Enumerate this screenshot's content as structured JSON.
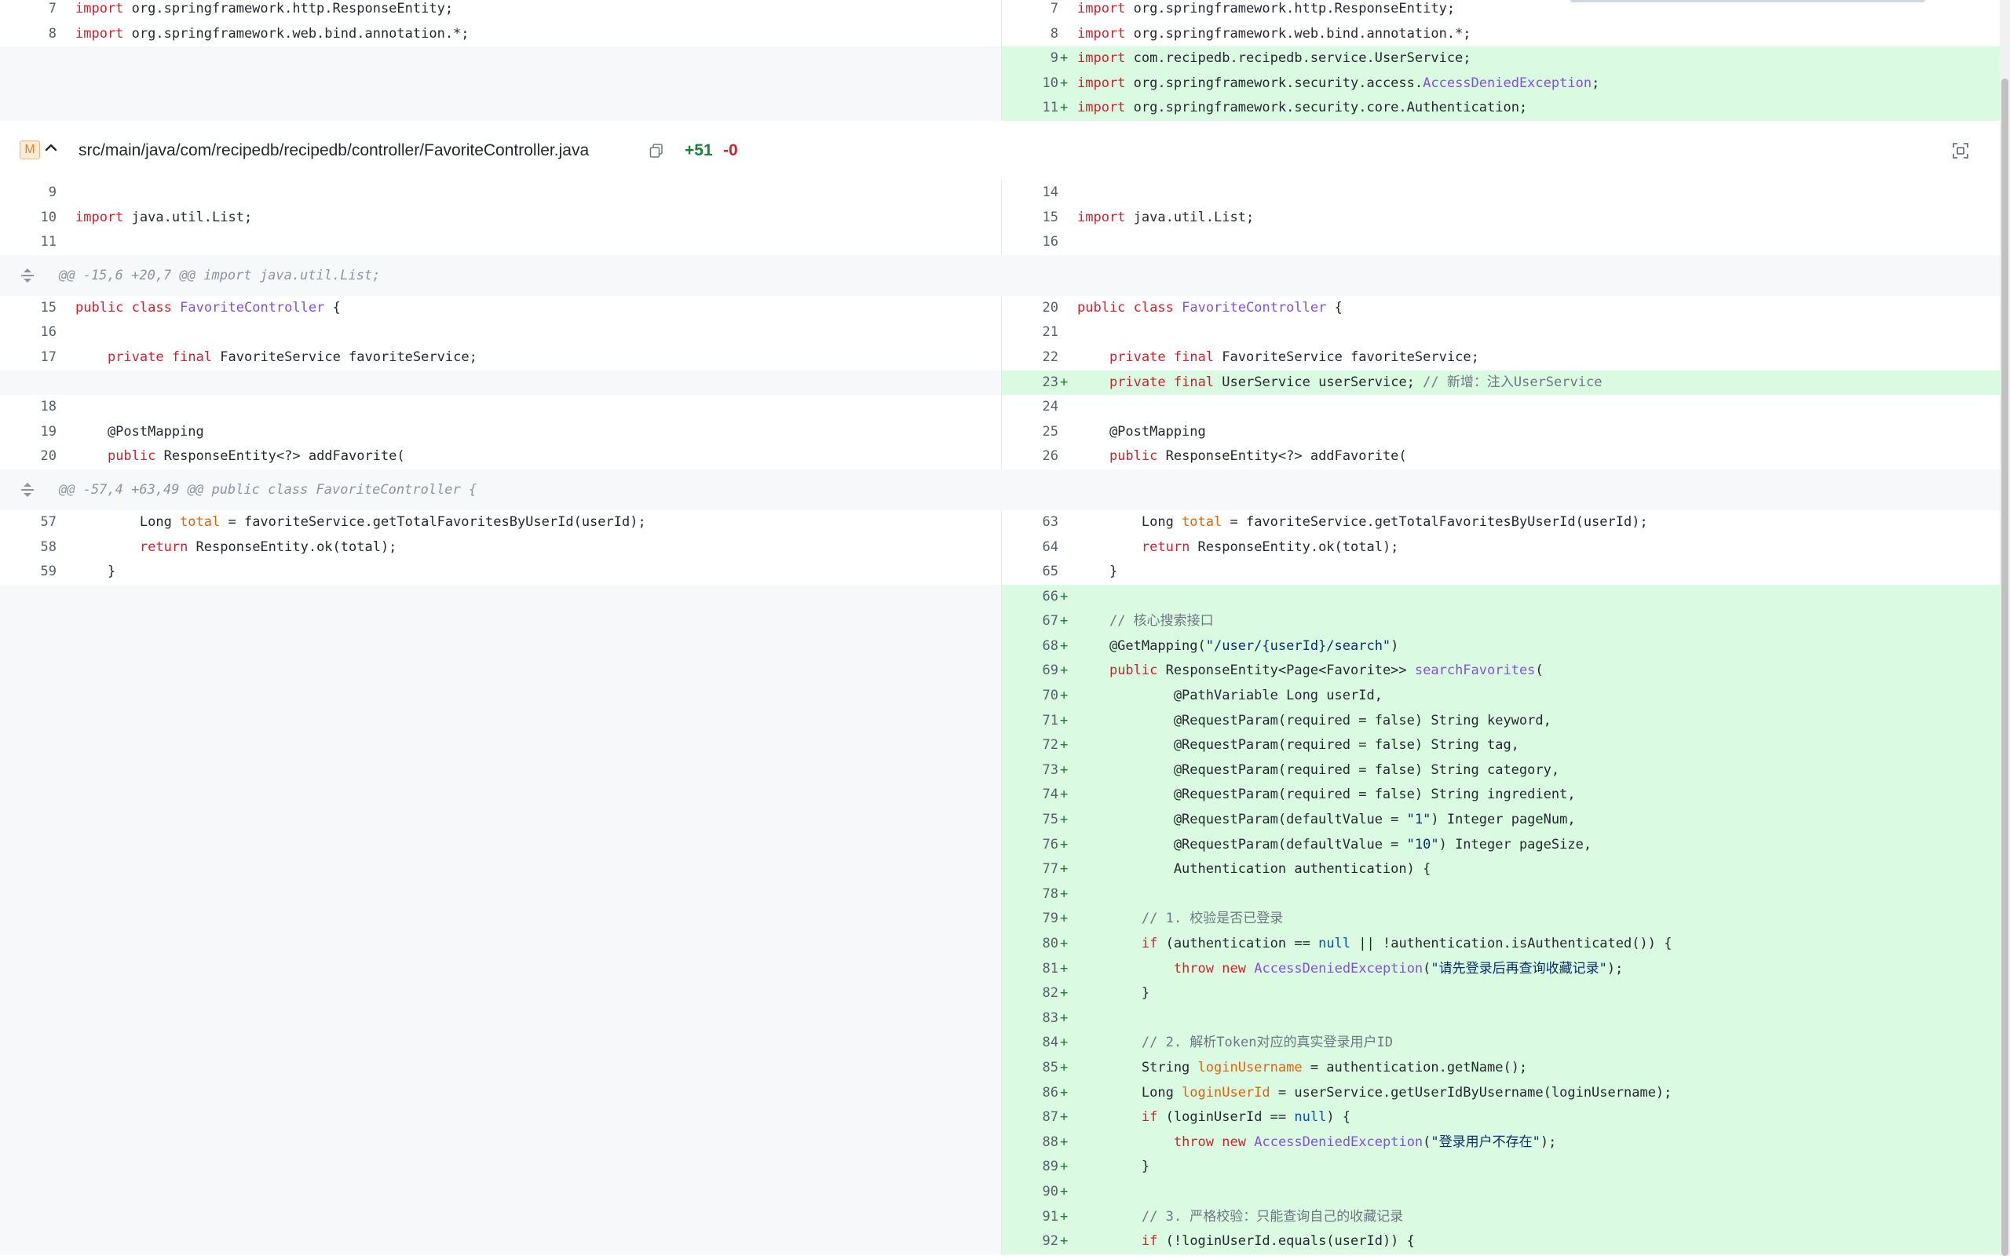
{
  "file": {
    "status_badge": "M",
    "path": "src/main/java/com/recipedb/recipedb/controller/FavoriteController.java",
    "additions": "+51",
    "deletions": "-0"
  },
  "hunks": [
    "@@ -15,6 +20,7 @@ import java.util.List;",
    "@@ -57,4 +63,49 @@ public class FavoriteController {"
  ],
  "top_rows": [
    {
      "l_num": "7",
      "r_num": "7",
      "text": "import org.springframework.http.ResponseEntity;"
    },
    {
      "l_num": "8",
      "r_num": "8",
      "text": "import org.springframework.web.bind.annotation.*;"
    },
    {
      "l_num": "",
      "r_num": "9",
      "text": "import com.recipedb.recipedb.service.UserService;"
    },
    {
      "l_num": "",
      "r_num": "10",
      "text": "import org.springframework.security.access.AccessDeniedException;"
    },
    {
      "l_num": "",
      "r_num": "11",
      "text": "import org.springframework.security.core.Authentication;"
    }
  ],
  "block1": [
    {
      "l_num": "9",
      "r_num": "14",
      "text": ""
    },
    {
      "l_num": "10",
      "r_num": "15",
      "text": "import java.util.List;"
    },
    {
      "l_num": "11",
      "r_num": "16",
      "text": ""
    }
  ],
  "block2": [
    {
      "l_num": "15",
      "r_num": "20",
      "text": "public class FavoriteController {"
    },
    {
      "l_num": "16",
      "r_num": "21",
      "text": ""
    },
    {
      "l_num": "17",
      "r_num": "22",
      "text": "    private final FavoriteService favoriteService;"
    },
    {
      "l_num": "",
      "r_num": "23",
      "text": "    private final UserService userService; // 新增：注入UserService"
    },
    {
      "l_num": "18",
      "r_num": "24",
      "text": ""
    },
    {
      "l_num": "19",
      "r_num": "25",
      "text": "    @PostMapping"
    },
    {
      "l_num": "20",
      "r_num": "26",
      "text": "    public ResponseEntity<?> addFavorite("
    }
  ],
  "block3": [
    {
      "l_num": "57",
      "r_num": "63",
      "text": "        Long total = favoriteService.getTotalFavoritesByUserId(userId);"
    },
    {
      "l_num": "58",
      "r_num": "64",
      "text": "        return ResponseEntity.ok(total);"
    },
    {
      "l_num": "59",
      "r_num": "65",
      "text": "    }"
    }
  ],
  "added_rows": [
    {
      "r_num": "66",
      "text": ""
    },
    {
      "r_num": "67",
      "text": "    // 核心搜索接口"
    },
    {
      "r_num": "68",
      "text": "    @GetMapping(\"/user/{userId}/search\")"
    },
    {
      "r_num": "69",
      "text": "    public ResponseEntity<Page<Favorite>> searchFavorites("
    },
    {
      "r_num": "70",
      "text": "            @PathVariable Long userId,"
    },
    {
      "r_num": "71",
      "text": "            @RequestParam(required = false) String keyword,"
    },
    {
      "r_num": "72",
      "text": "            @RequestParam(required = false) String tag,"
    },
    {
      "r_num": "73",
      "text": "            @RequestParam(required = false) String category,"
    },
    {
      "r_num": "74",
      "text": "            @RequestParam(required = false) String ingredient,"
    },
    {
      "r_num": "75",
      "text": "            @RequestParam(defaultValue = \"1\") Integer pageNum,"
    },
    {
      "r_num": "76",
      "text": "            @RequestParam(defaultValue = \"10\") Integer pageSize,"
    },
    {
      "r_num": "77",
      "text": "            Authentication authentication) {"
    },
    {
      "r_num": "78",
      "text": ""
    },
    {
      "r_num": "79",
      "text": "        // 1. 校验是否已登录"
    },
    {
      "r_num": "80",
      "text": "        if (authentication == null || !authentication.isAuthenticated()) {"
    },
    {
      "r_num": "81",
      "text": "            throw new AccessDeniedException(\"请先登录后再查询收藏记录\");"
    },
    {
      "r_num": "82",
      "text": "        }"
    },
    {
      "r_num": "83",
      "text": ""
    },
    {
      "r_num": "84",
      "text": "        // 2. 解析Token对应的真实登录用户ID"
    },
    {
      "r_num": "85",
      "text": "        String loginUsername = authentication.getName();"
    },
    {
      "r_num": "86",
      "text": "        Long loginUserId = userService.getUserIdByUsername(loginUsername);"
    },
    {
      "r_num": "87",
      "text": "        if (loginUserId == null) {"
    },
    {
      "r_num": "88",
      "text": "            throw new AccessDeniedException(\"登录用户不存在\");"
    },
    {
      "r_num": "89",
      "text": "        }"
    },
    {
      "r_num": "90",
      "text": ""
    },
    {
      "r_num": "91",
      "text": "        // 3. 严格校验：只能查询自己的收藏记录"
    },
    {
      "r_num": "92",
      "text": "        if (!loginUserId.equals(userId)) {"
    }
  ],
  "colors": {
    "added_bg": "#dafbe1",
    "context_bg": "#ffffff",
    "hunk_bg": "#f6f8fa",
    "keyword": "#cf222e",
    "class_name": "#8250df",
    "comment": "#6e7781",
    "addition_count": "#1a7f37",
    "deletion_count": "#cf222e"
  },
  "icons": {
    "expand": "unfold-icon",
    "collapse": "chevron-up-icon",
    "copy": "copy-icon",
    "fullscreen": "focus-icon"
  }
}
